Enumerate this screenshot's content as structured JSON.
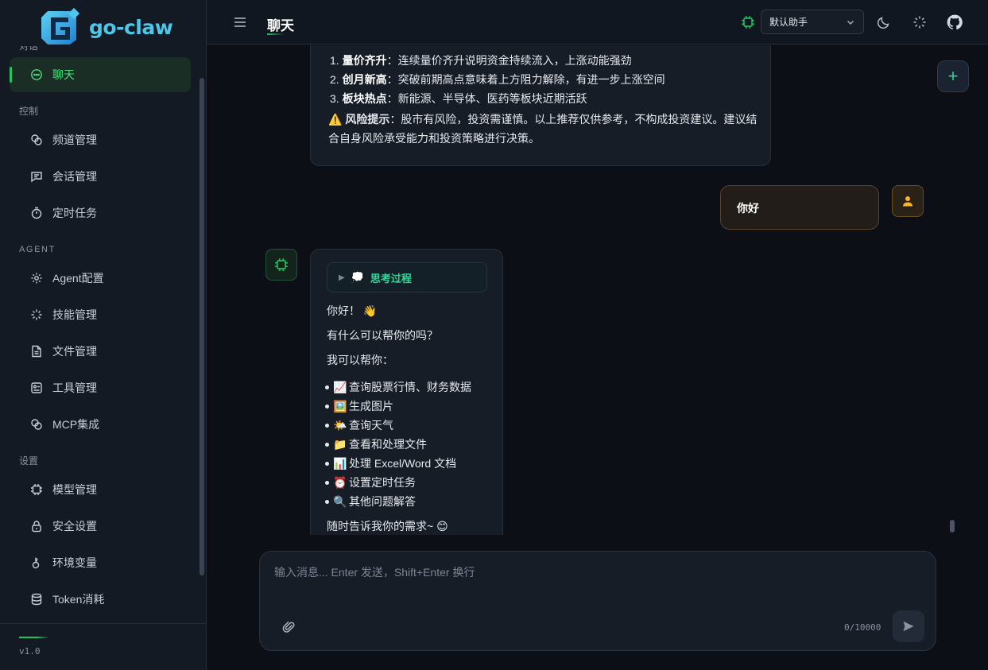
{
  "brand": {
    "name": "go-claw",
    "version": "v1.0"
  },
  "sidebar": {
    "sections": [
      {
        "label": "对话",
        "items": [
          {
            "label": "聊天",
            "icon": "chat-icon",
            "active": true
          }
        ]
      },
      {
        "label": "控制",
        "items": [
          {
            "label": "频道管理",
            "icon": "link-icon"
          },
          {
            "label": "会话管理",
            "icon": "message-square-icon"
          },
          {
            "label": "定时任务",
            "icon": "timer-icon"
          }
        ]
      },
      {
        "label": "AGENT",
        "items": [
          {
            "label": "Agent配置",
            "icon": "gear-icon"
          },
          {
            "label": "技能管理",
            "icon": "sparkle-icon"
          },
          {
            "label": "文件管理",
            "icon": "file-icon"
          },
          {
            "label": "工具管理",
            "icon": "tool-icon"
          },
          {
            "label": "MCP集成",
            "icon": "link-icon"
          }
        ]
      },
      {
        "label": "设置",
        "items": [
          {
            "label": "模型管理",
            "icon": "cpu-icon"
          },
          {
            "label": "安全设置",
            "icon": "lock-icon"
          },
          {
            "label": "环境变量",
            "icon": "key-icon"
          },
          {
            "label": "Token消耗",
            "icon": "database-icon"
          }
        ]
      }
    ]
  },
  "header": {
    "title": "聊天",
    "assistant_select": "默认助手"
  },
  "messages": {
    "first_ai": {
      "list": [
        {
          "num": "1.",
          "bold": "量价齐升",
          "text": "：连续量价齐升说明资金持续流入，上涨动能强劲"
        },
        {
          "num": "2.",
          "bold": "创月新高",
          "text": "：突破前期高点意味着上方阻力解除，有进一步上涨空间"
        },
        {
          "num": "3.",
          "bold": "板块热点",
          "text": "：新能源、半导体、医药等板块近期活跃"
        }
      ],
      "warning_icon": "⚠️",
      "warning_bold": "风险提示",
      "warning_text": "：股市有风险，投资需谨慎。以上推荐仅供参考，不构成投资建议。建议结合自身风险承受能力和投资策略进行决策。"
    },
    "user": {
      "text": "你好"
    },
    "second_ai": {
      "thinking_label": "思考过程",
      "thinking_emoji": "💭",
      "greeting": "你好！",
      "greeting_emoji": "👋",
      "ask": "有什么可以帮你的吗？",
      "intro": "我可以帮你：",
      "capabilities": [
        {
          "emoji": "📈",
          "text": "查询股票行情、财务数据"
        },
        {
          "emoji": "🖼️",
          "text": "生成图片"
        },
        {
          "emoji": "🌤️",
          "text": "查询天气"
        },
        {
          "emoji": "📁",
          "text": "查看和处理文件"
        },
        {
          "emoji": "📊",
          "text": "处理 Excel/Word 文档"
        },
        {
          "emoji": "⏰",
          "text": "设置定时任务"
        },
        {
          "emoji": "🔍",
          "text": "其他问题解答"
        }
      ],
      "closing": "随时告诉我你的需求~",
      "closing_emoji": "😊"
    }
  },
  "composer": {
    "placeholder": "输入消息... Enter 发送，Shift+Enter 换行",
    "value": "",
    "counter": "0/10000"
  },
  "colors": {
    "accent": "#22c55e",
    "brand": "#4cc7ea",
    "background": "#0c1016",
    "user_accent": "#f5b533"
  }
}
